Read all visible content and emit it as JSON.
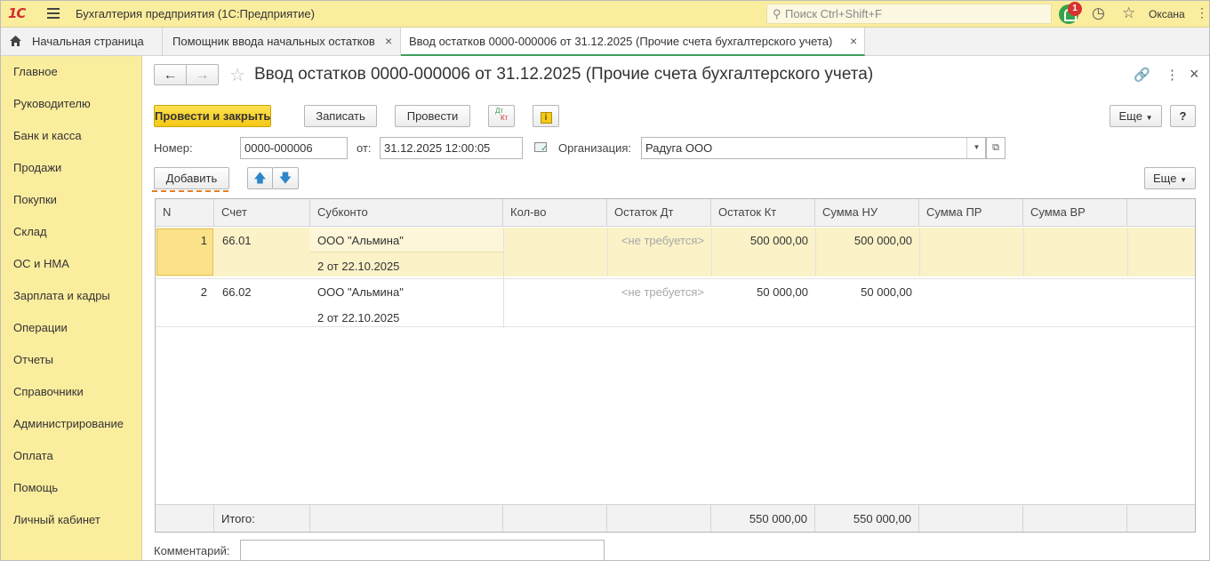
{
  "app": {
    "logo": "1С",
    "title": "Бухгалтерия предприятия  (1С:Предприятие)",
    "search_placeholder": "Поиск Ctrl+Shift+F",
    "notifications_count": "1",
    "user": "Оксана",
    "icons": [
      "menu-icon",
      "search-icon",
      "bell-icon",
      "history-icon",
      "star-icon",
      "more-icon"
    ]
  },
  "tabs": [
    {
      "label": "Начальная страница"
    },
    {
      "label": "Помощник ввода начальных остатков"
    },
    {
      "label": "Ввод остатков 0000-000006 от 31.12.2025 (Прочие счета бухгалтерского учета)"
    }
  ],
  "sidebar": {
    "items": [
      {
        "label": "Главное"
      },
      {
        "label": "Руководителю"
      },
      {
        "label": "Банк и касса"
      },
      {
        "label": "Продажи"
      },
      {
        "label": "Покупки"
      },
      {
        "label": "Склад"
      },
      {
        "label": "ОС и НМА"
      },
      {
        "label": "Зарплата и кадры"
      },
      {
        "label": "Операции"
      },
      {
        "label": "Отчеты"
      },
      {
        "label": "Справочники"
      },
      {
        "label": "Администрирование"
      },
      {
        "label": "Оплата"
      },
      {
        "label": "Помощь"
      },
      {
        "label": "Личный кабинет"
      }
    ]
  },
  "form": {
    "title": "Ввод остатков 0000-000006 от 31.12.2025 (Прочие счета бухгалтерского учета)",
    "toolbar": {
      "post_and_close": "Провести и закрыть",
      "save": "Записать",
      "post": "Провести",
      "dtkt_top": "Дт",
      "dtkt_bottom": "Кт",
      "info": "i",
      "more": "Еще"
    },
    "number_label": "Номер:",
    "number_value": "0000-000006",
    "date_label": "от:",
    "date_value": "31.12.2025 12:00:05",
    "org_label": "Организация:",
    "org_value": "Радуга ООО",
    "add_button": "Добавить",
    "table_more": "Еще",
    "comment_label": "Комментарий:",
    "comment_value": ""
  },
  "table": {
    "columns": [
      "N",
      "Счет",
      "Субконто",
      "Кол-во",
      "Остаток Дт",
      "Остаток Кт",
      "Сумма НУ",
      "Сумма ПР",
      "Сумма ВР"
    ],
    "rows": [
      {
        "n": "1",
        "account": "66.01",
        "subconto1": "ООО \"Альмина\"",
        "subconto2": "2 от 22.10.2025",
        "qty": "",
        "debit": "<не требуется>",
        "credit": "500 000,00",
        "sum_nu": "500 000,00",
        "sum_pr": "",
        "sum_vr": ""
      },
      {
        "n": "2",
        "account": "66.02",
        "subconto1": "ООО \"Альмина\"",
        "subconto2": "2 от 22.10.2025",
        "qty": "",
        "debit": "<не требуется>",
        "credit": "50 000,00",
        "sum_nu": "50 000,00",
        "sum_pr": "",
        "sum_vr": ""
      }
    ],
    "footer": {
      "label": "Итого:",
      "credit": "550 000,00",
      "sum_nu": "550 000,00"
    }
  },
  "colors": {
    "panel": "#fbed9e",
    "primary_button": "#f5c916",
    "selected_row": "#fbf2c8",
    "active_tab": "#3d9e5a"
  }
}
